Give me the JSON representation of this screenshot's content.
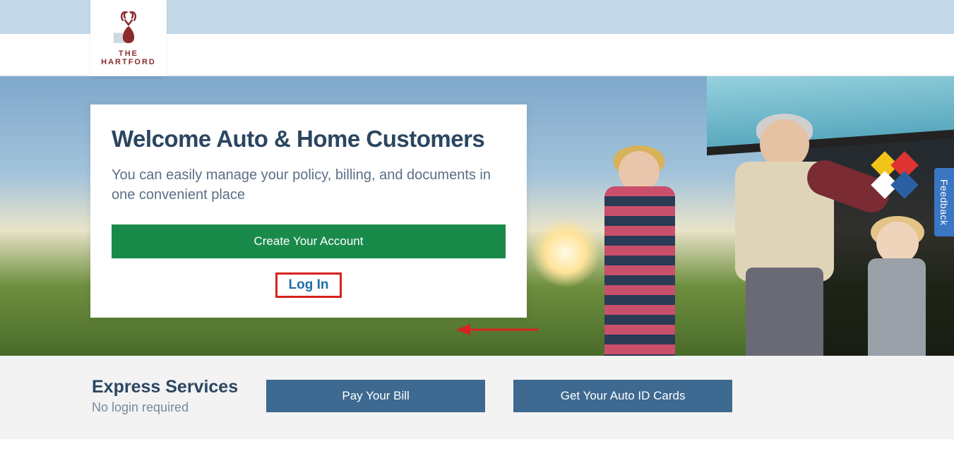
{
  "brand": {
    "line1": "THE",
    "line2": "HARTFORD"
  },
  "hero": {
    "title": "Welcome Auto & Home Customers",
    "subtitle": "You can easily manage your policy, billing, and documents in one convenient place",
    "create_label": "Create Your Account",
    "login_label": "Log In"
  },
  "express": {
    "title": "Express Services",
    "subtitle": "No login required",
    "pay_label": "Pay Your Bill",
    "id_label": "Get Your Auto ID Cards"
  },
  "feedback_label": "Feedback",
  "colors": {
    "accent_green": "#1a8a4b",
    "accent_blue_dark": "#3e6990",
    "brand_maroon": "#8b2b2d",
    "highlight_red": "#d6231f",
    "feedback_blue": "#3b76c2"
  }
}
